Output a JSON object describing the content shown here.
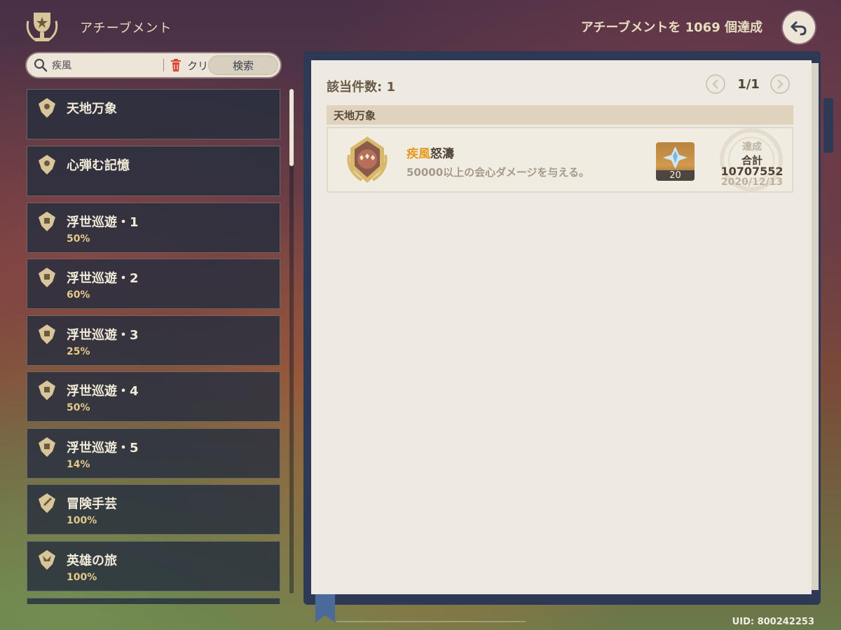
{
  "header": {
    "title": "アチーブメント",
    "summary": "アチーブメントを 1069 個達成"
  },
  "search": {
    "query": "疾風",
    "clear_label": "クリア",
    "search_label": "検索"
  },
  "categories": [
    {
      "name": "天地万象",
      "percent": ""
    },
    {
      "name": "心弾む記憶",
      "percent": ""
    },
    {
      "name": "浮世巡遊・1",
      "percent": "50%"
    },
    {
      "name": "浮世巡遊・2",
      "percent": "60%"
    },
    {
      "name": "浮世巡遊・3",
      "percent": "25%"
    },
    {
      "name": "浮世巡遊・4",
      "percent": "50%"
    },
    {
      "name": "浮世巡遊・5",
      "percent": "14%"
    },
    {
      "name": "冒険手芸",
      "percent": "100%"
    },
    {
      "name": "英雄の旅",
      "percent": "100%"
    }
  ],
  "results": {
    "count_label": "該当件数: 1",
    "page": "1/1",
    "group_title": "天地万象",
    "achievement": {
      "title_highlight": "疾風",
      "title_rest": "怒濤",
      "description": "50000以上の会心ダメージを与える。",
      "reward_count": "20",
      "stamp_label": "達成",
      "total_label": "合計",
      "total_value": "10707552",
      "date": "2020/12/13"
    }
  },
  "footer": {
    "uid": "UID: 800242253"
  },
  "colors": {
    "accent_gold": "#e49a20",
    "panel_dark": "#262e3e",
    "page_bg": "#eee9e1"
  }
}
